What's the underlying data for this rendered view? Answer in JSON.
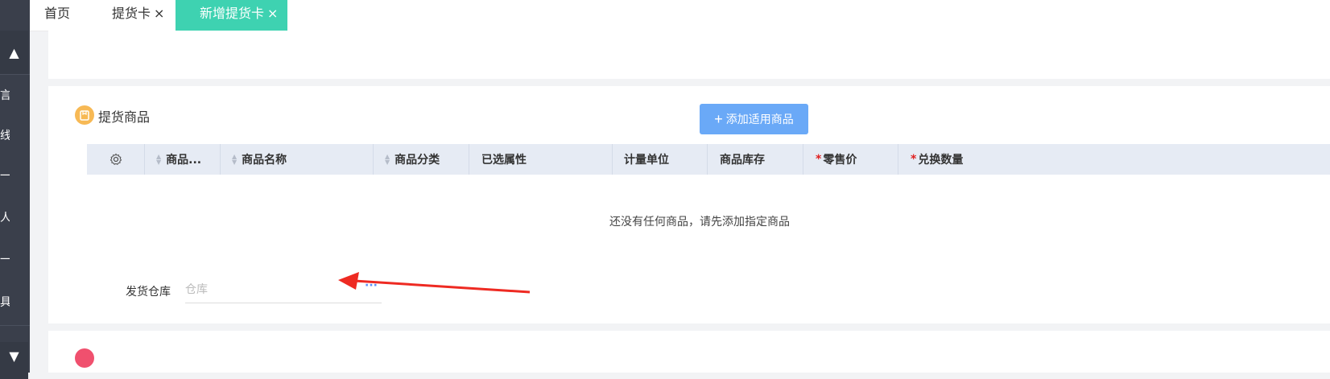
{
  "tabs": [
    {
      "label": "首页",
      "closable": false
    },
    {
      "label": "提货卡",
      "closable": true
    },
    {
      "label": "新增提货卡",
      "closable": true,
      "active": true
    }
  ],
  "tab_close_glyph": "×",
  "sidebar": {
    "fragments": [
      "言",
      "线",
      "一",
      "人",
      "一",
      "具"
    ]
  },
  "section": {
    "title": "提货商品",
    "add_button_label": "添加适用商品",
    "columns": [
      {
        "label": "商品...",
        "sortable": true
      },
      {
        "label": "商品名称",
        "sortable": true
      },
      {
        "label": "商品分类",
        "sortable": true
      },
      {
        "label": "已选属性",
        "sortable": false
      },
      {
        "label": "计量单位",
        "sortable": false
      },
      {
        "label": "商品库存",
        "sortable": false
      },
      {
        "label": "零售价",
        "required": true
      },
      {
        "label": "兑换数量",
        "required": true
      }
    ],
    "empty_text": "还没有任何商品，请先添加指定商品",
    "warehouse": {
      "label": "发货仓库",
      "value": "",
      "placeholder": "仓库",
      "more": "···"
    },
    "required_mark": "*"
  },
  "colors": {
    "active_tab": "#3ed2b1",
    "primary_button": "#6aa9f7",
    "section_icon": "#f7b955",
    "table_header": "#e6ebf4",
    "annotation_arrow": "#ee2a22"
  }
}
